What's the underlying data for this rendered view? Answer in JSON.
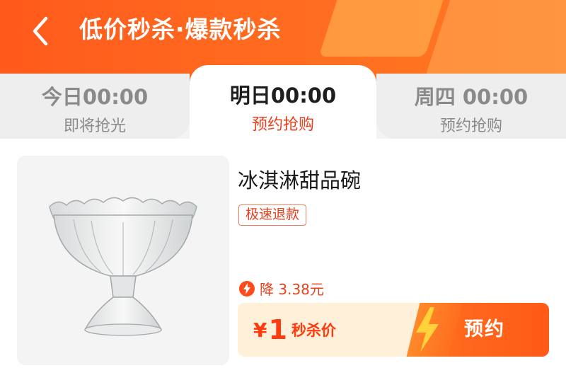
{
  "header": {
    "title": "低价秒杀·爆款秒杀",
    "back_icon": "chevron-left-icon",
    "colors": {
      "start": "#ff5a1c",
      "end": "#ff7a22"
    }
  },
  "tabs": [
    {
      "time": "今日00:00",
      "status": "即将抢光",
      "active": false
    },
    {
      "time": "明日00:00",
      "status": "预约抢购",
      "active": true
    },
    {
      "time": "周四 00:00",
      "status": "预约抢购",
      "active": false
    }
  ],
  "product": {
    "name": "冰淇淋甜品碗",
    "tag": "极速退款",
    "discount_label": "降 3.38元",
    "price_symbol": "¥",
    "price": "1",
    "price_label": "秒杀价",
    "reserve_button": "预约",
    "accent_color": "#e8411f"
  }
}
